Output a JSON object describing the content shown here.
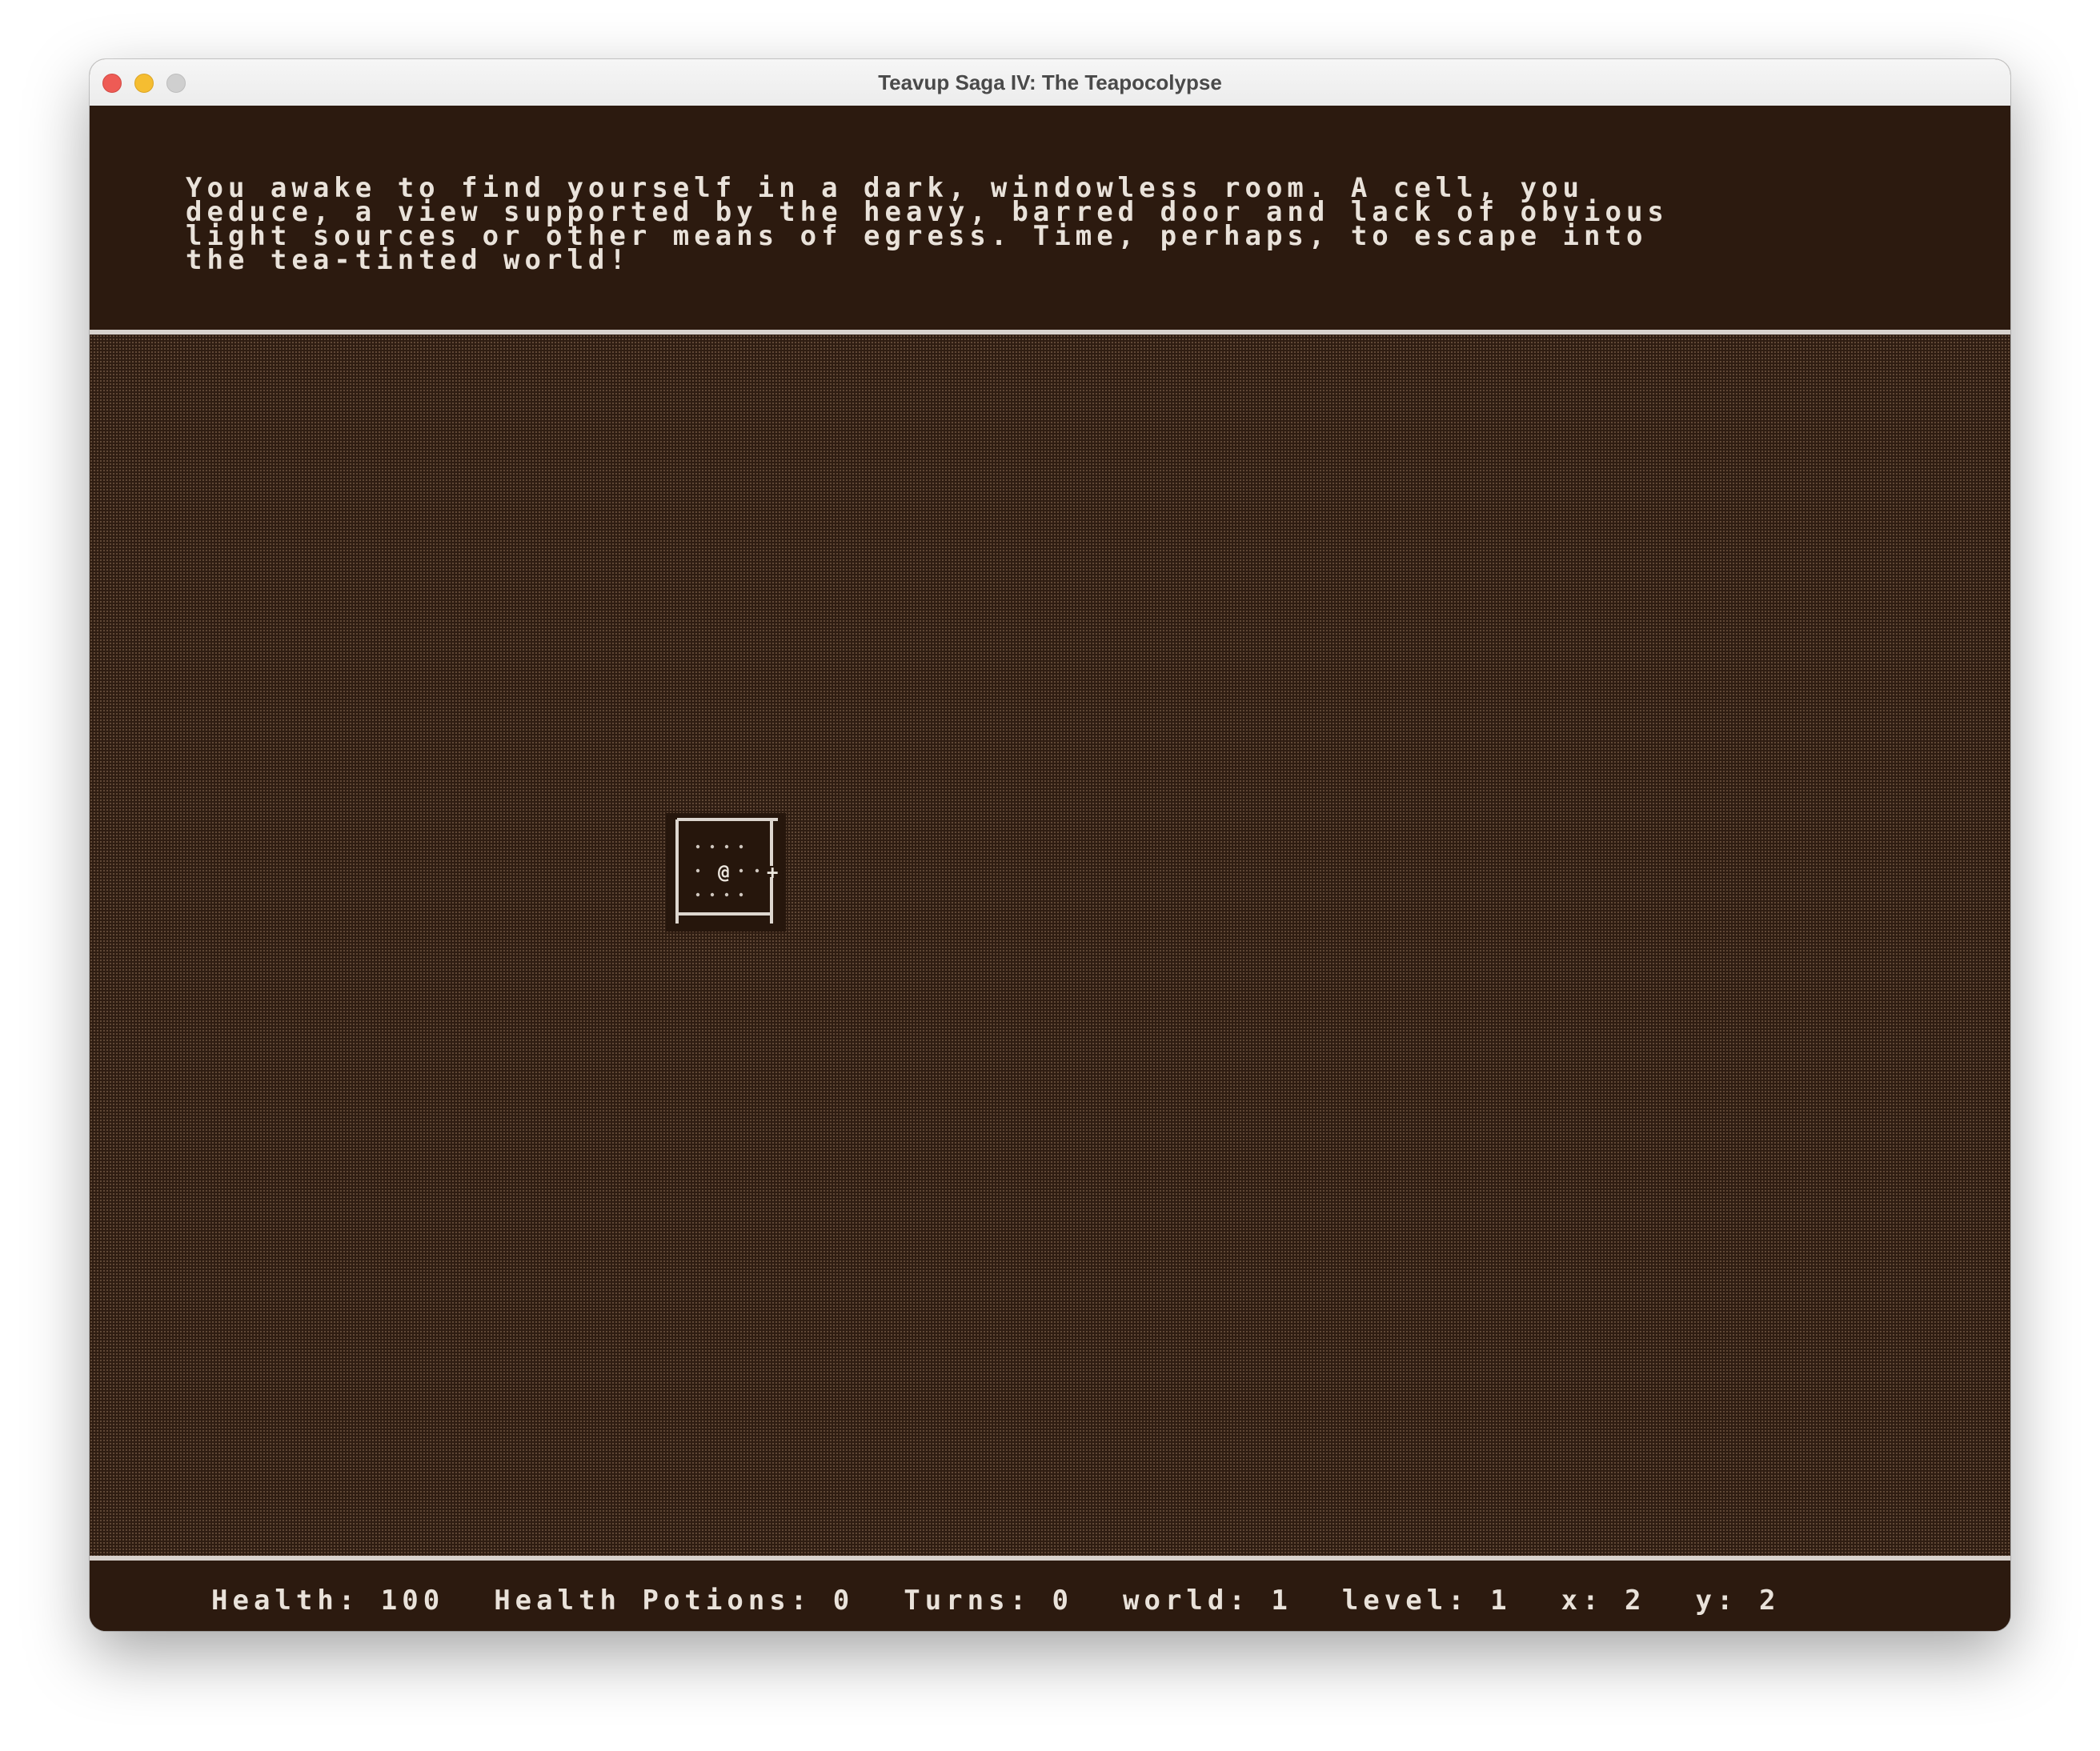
{
  "window": {
    "title": "Teavup Saga IV: The Teapocolypse"
  },
  "message": {
    "text": "You awake to find yourself in a dark, windowless room. A cell, you\ndeduce, a view supported by the heavy, barred door and lack of obvious\nlight sources or other means of egress. Time, perhaps, to escape into\nthe tea-tinted world!"
  },
  "map": {
    "player_glyph": "@",
    "door_glyph": "+",
    "floor_glyph": "."
  },
  "status": {
    "health_label": "Health:",
    "health_value": "100",
    "potions_label": "Health Potions:",
    "potions_value": "0",
    "turns_label": "Turns:",
    "turns_value": "0",
    "world_label": "world:",
    "world_value": "1",
    "level_label": "level:",
    "level_value": "1",
    "x_label": "x:",
    "x_value": "2",
    "y_label": "y:",
    "y_value": "2"
  },
  "colors": {
    "background": "#2c1a0f",
    "text": "#e9e2da",
    "divider": "#d8d2cd"
  }
}
